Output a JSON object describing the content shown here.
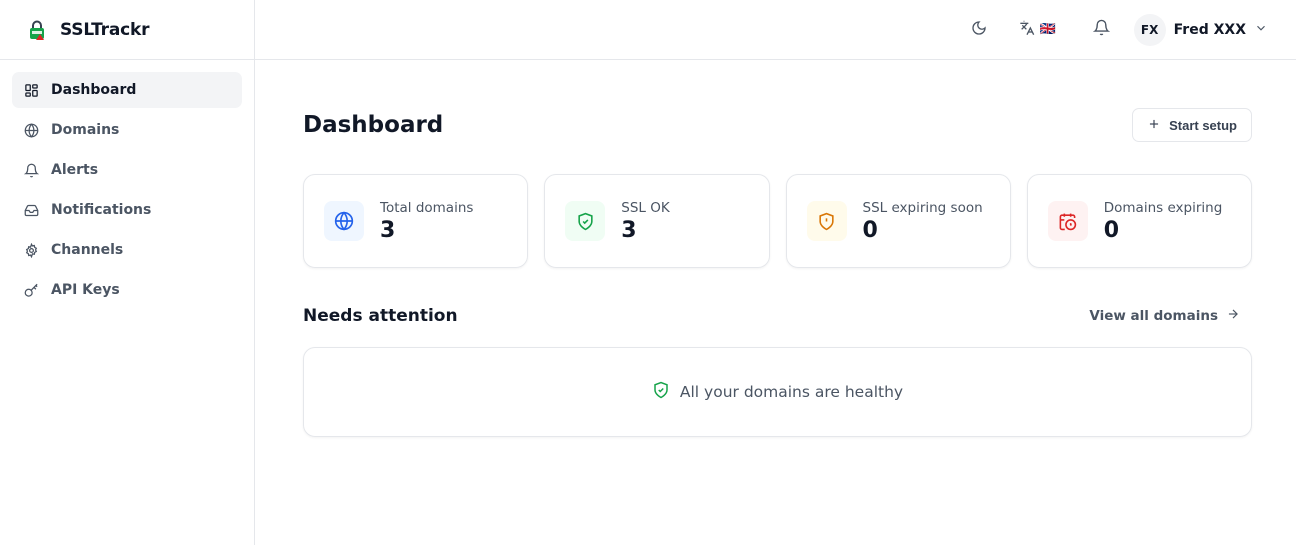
{
  "brand": {
    "name": "SSLTrackr",
    "logo_icon": "lock-logo-icon"
  },
  "sidebar": {
    "items": [
      {
        "label": "Dashboard",
        "icon": "dashboard-icon",
        "active": true
      },
      {
        "label": "Domains",
        "icon": "globe-icon"
      },
      {
        "label": "Alerts",
        "icon": "bell-icon"
      },
      {
        "label": "Notifications",
        "icon": "inbox-icon"
      },
      {
        "label": "Channels",
        "icon": "gear-icon"
      },
      {
        "label": "API Keys",
        "icon": "key-icon"
      }
    ]
  },
  "topbar": {
    "theme_icon": "moon-icon",
    "language_icon": "translate-icon",
    "language_flag": "🇬🇧",
    "notifications_icon": "bell-icon",
    "user": {
      "initials": "FX",
      "name": "Fred XXX"
    }
  },
  "page": {
    "title": "Dashboard",
    "setup_button": "Start setup"
  },
  "stats": [
    {
      "label": "Total domains",
      "value": "3",
      "icon": "globe-icon",
      "color": "#2563eb",
      "bg": "#eff6ff"
    },
    {
      "label": "SSL OK",
      "value": "3",
      "icon": "shield-check-icon",
      "color": "#16a34a",
      "bg": "#f0fdf4"
    },
    {
      "label": "SSL expiring soon",
      "value": "0",
      "icon": "shield-alert-icon",
      "color": "#d97706",
      "bg": "#fffbeb"
    },
    {
      "label": "Domains expiring",
      "value": "0",
      "icon": "calendar-clock-icon",
      "color": "#dc2626",
      "bg": "#fef2f2"
    }
  ],
  "attention": {
    "title": "Needs attention",
    "view_all": "View all domains",
    "healthy_message": "All your domains are healthy",
    "healthy_color": "#16a34a"
  }
}
